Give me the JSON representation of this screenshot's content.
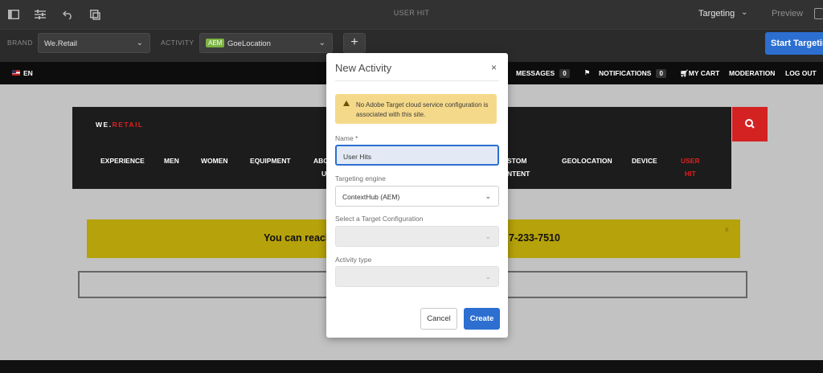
{
  "toolbar": {
    "title": "USER HIT",
    "mode": "Targeting",
    "preview": "Preview"
  },
  "targeting": {
    "brand_label": "BRAND",
    "brand_value": "We.Retail",
    "activity_label": "ACTIVITY",
    "activity_badge": "AEM",
    "activity_value": "GoeLocation",
    "add_symbol": "+",
    "start_button": "Start Targeting"
  },
  "site_header": {
    "language": "EN",
    "messages_label": "MESSAGES",
    "messages_count": "0",
    "notifications_label": "NOTIFICATIONS",
    "notifications_count": "0",
    "cart": "MY CART",
    "moderation": "MODERATION",
    "logout": "LOG OUT"
  },
  "site": {
    "brand_prefix": "WE.",
    "brand_suffix": "RETAIL",
    "nav": [
      "EXPERIENCE",
      "MEN",
      "WOMEN",
      "EQUIPMENT"
    ],
    "nav_partial_about_1": "ABO",
    "nav_partial_about_2": "U",
    "nav_partial_custom_1": "STOM",
    "nav_partial_custom_2": "NTENT",
    "nav_geo": "GEOLOCATION",
    "nav_device": "DEVICE",
    "nav_userhit_1": "USER",
    "nav_userhit_2": "HIT",
    "banner_left": "You can reach",
    "banner_right": "7-233-7510",
    "banner_close": "x"
  },
  "modal": {
    "title": "New Activity",
    "close": "×",
    "alert": "No Adobe Target cloud service configuration is associated with this site.",
    "name_label": "Name *",
    "name_value": "User Hits",
    "engine_label": "Targeting engine",
    "engine_value": "ContextHub (AEM)",
    "target_config_label": "Select a Target Configuration",
    "activity_type_label": "Activity type",
    "cancel": "Cancel",
    "create": "Create"
  },
  "colors": {
    "accent": "#2c6fd1",
    "alert_bg": "#f5d98a",
    "banner": "#b6a20a",
    "brand_red": "#e02020"
  }
}
